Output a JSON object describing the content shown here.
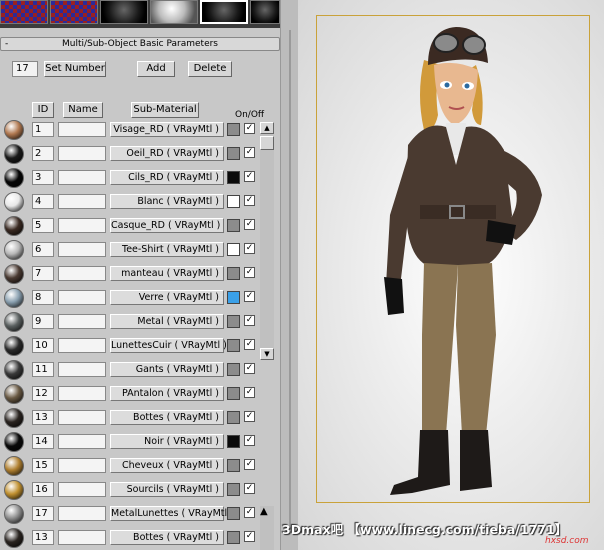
{
  "rollout": {
    "title": "Multi/Sub-Object Basic Parameters",
    "collapse_glyph": "-"
  },
  "controls": {
    "count": "17",
    "set_number_label": "Set Number",
    "add_label": "Add",
    "delete_label": "Delete"
  },
  "columns": {
    "id": "ID",
    "name": "Name",
    "sub_material": "Sub-Material",
    "on_off": "On/Off"
  },
  "rows": [
    {
      "id": "1",
      "material": "Visage_RD  ( VRayMtl )",
      "swatch": "#8c8c8c",
      "ball": "#b07850",
      "on": true
    },
    {
      "id": "2",
      "material": "Oeil_RD  ( VRayMtl )",
      "swatch": "#8c8c8c",
      "ball": "#1a1a1a",
      "on": true
    },
    {
      "id": "3",
      "material": "Cils_RD  ( VRayMtl )",
      "swatch": "#0a0a0a",
      "ball": "#050505",
      "on": true
    },
    {
      "id": "4",
      "material": "Blanc  ( VRayMtl )",
      "swatch": "#ffffff",
      "ball": "#e8e8e8",
      "on": true
    },
    {
      "id": "5",
      "material": "Casque_RD  ( VRayMtl )",
      "swatch": "#8c8c8c",
      "ball": "#3a2a22",
      "on": true
    },
    {
      "id": "6",
      "material": "Tee-Shirt  ( VRayMtl )",
      "swatch": "#ffffff",
      "ball": "#b8b8b8",
      "on": true
    },
    {
      "id": "7",
      "material": "manteau  ( VRayMtl )",
      "swatch": "#8c8c8c",
      "ball": "#4a3a32",
      "on": true
    },
    {
      "id": "8",
      "material": "Verre  ( VRayMtl )",
      "swatch": "#3aa0e8",
      "ball": "#8aa0b0",
      "on": true
    },
    {
      "id": "9",
      "material": "Metal  ( VRayMtl )",
      "swatch": "#8c8c8c",
      "ball": "#5a6060",
      "on": true
    },
    {
      "id": "10",
      "material": "LunettesCuir  ( VRayMtl )",
      "swatch": "#8c8c8c",
      "ball": "#2a2a2a",
      "on": true
    },
    {
      "id": "11",
      "material": "Gants  ( VRayMtl )",
      "swatch": "#8c8c8c",
      "ball": "#3a3a3a",
      "on": true
    },
    {
      "id": "12",
      "material": "PAntalon  ( VRayMtl )",
      "swatch": "#8c8c8c",
      "ball": "#6a5a44",
      "on": true
    },
    {
      "id": "13",
      "material": "Bottes  ( VRayMtl )",
      "swatch": "#8c8c8c",
      "ball": "#2a2420",
      "on": true
    },
    {
      "id": "14",
      "material": "Noir  ( VRayMtl )",
      "swatch": "#0a0a0a",
      "ball": "#0a0a0a",
      "on": true
    },
    {
      "id": "15",
      "material": "Cheveux  ( VRayMtl )",
      "swatch": "#8c8c8c",
      "ball": "#b08030",
      "on": true
    },
    {
      "id": "16",
      "material": "Sourcils  ( VRayMtl )",
      "swatch": "#8c8c8c",
      "ball": "#c09030",
      "on": true
    },
    {
      "id": "17",
      "material": "MetalLunettes  ( VRayMtl )",
      "swatch": "#8c8c8c",
      "ball": "#909090",
      "on": true
    },
    {
      "id": "13",
      "material": "Bottes  ( VRayMtl )",
      "swatch": "#8c8c8c",
      "ball": "#2a2420",
      "on": true
    }
  ],
  "check_glyph": "✓",
  "watermark": "3Dmax吧 【www.linecg.com/tieba/1771】",
  "watermark_site": "hxsd.com",
  "colors": {
    "panel": "#c8c8c8",
    "safe_frame": "#c9a23a",
    "selected_swatch": "#3aa0e8"
  }
}
